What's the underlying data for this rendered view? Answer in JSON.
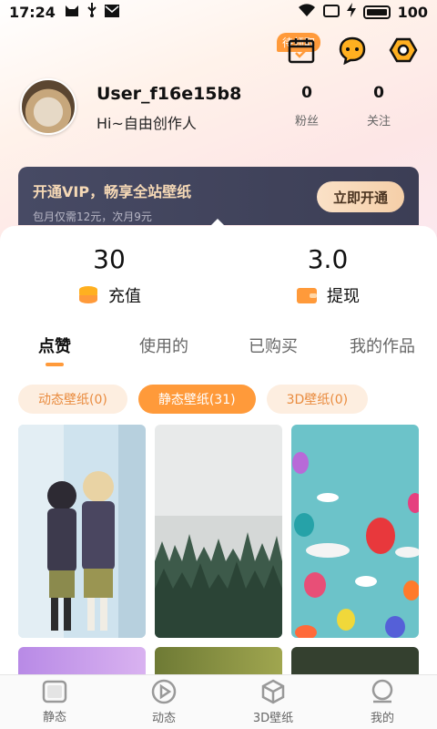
{
  "status_bar": {
    "time": "17:24",
    "battery": "100"
  },
  "header": {
    "pending_badge": "待领取"
  },
  "profile": {
    "username": "User_f16e15b8",
    "bio": "Hi~自由创作人",
    "fans_count": "0",
    "fans_label": "粉丝",
    "following_count": "0",
    "following_label": "关注"
  },
  "vip": {
    "title": "开通VIP，畅享全站壁纸",
    "subtitle": "包月仅需12元，次月9元",
    "button": "立即开通"
  },
  "wallet": {
    "recharge_value": "30",
    "recharge_label": "充值",
    "withdraw_value": "3.0",
    "withdraw_label": "提现"
  },
  "tabs": [
    {
      "label": "点赞",
      "active": true
    },
    {
      "label": "使用的",
      "active": false
    },
    {
      "label": "已购买",
      "active": false
    },
    {
      "label": "我的作品",
      "active": false
    }
  ],
  "filters": [
    {
      "label": "动态壁纸(0)",
      "active": false
    },
    {
      "label": "静态壁纸(31)",
      "active": true
    },
    {
      "label": "3D壁纸(0)",
      "active": false
    }
  ],
  "bottom_nav": [
    {
      "label": "静态",
      "icon": "image-icon"
    },
    {
      "label": "动态",
      "icon": "play-icon"
    },
    {
      "label": "3D壁纸",
      "icon": "cube-icon"
    },
    {
      "label": "我的",
      "icon": "user-icon"
    }
  ],
  "colors": {
    "accent": "#ff9a3a",
    "vip_bg": "#434660",
    "vip_text": "#f6d9b6"
  }
}
